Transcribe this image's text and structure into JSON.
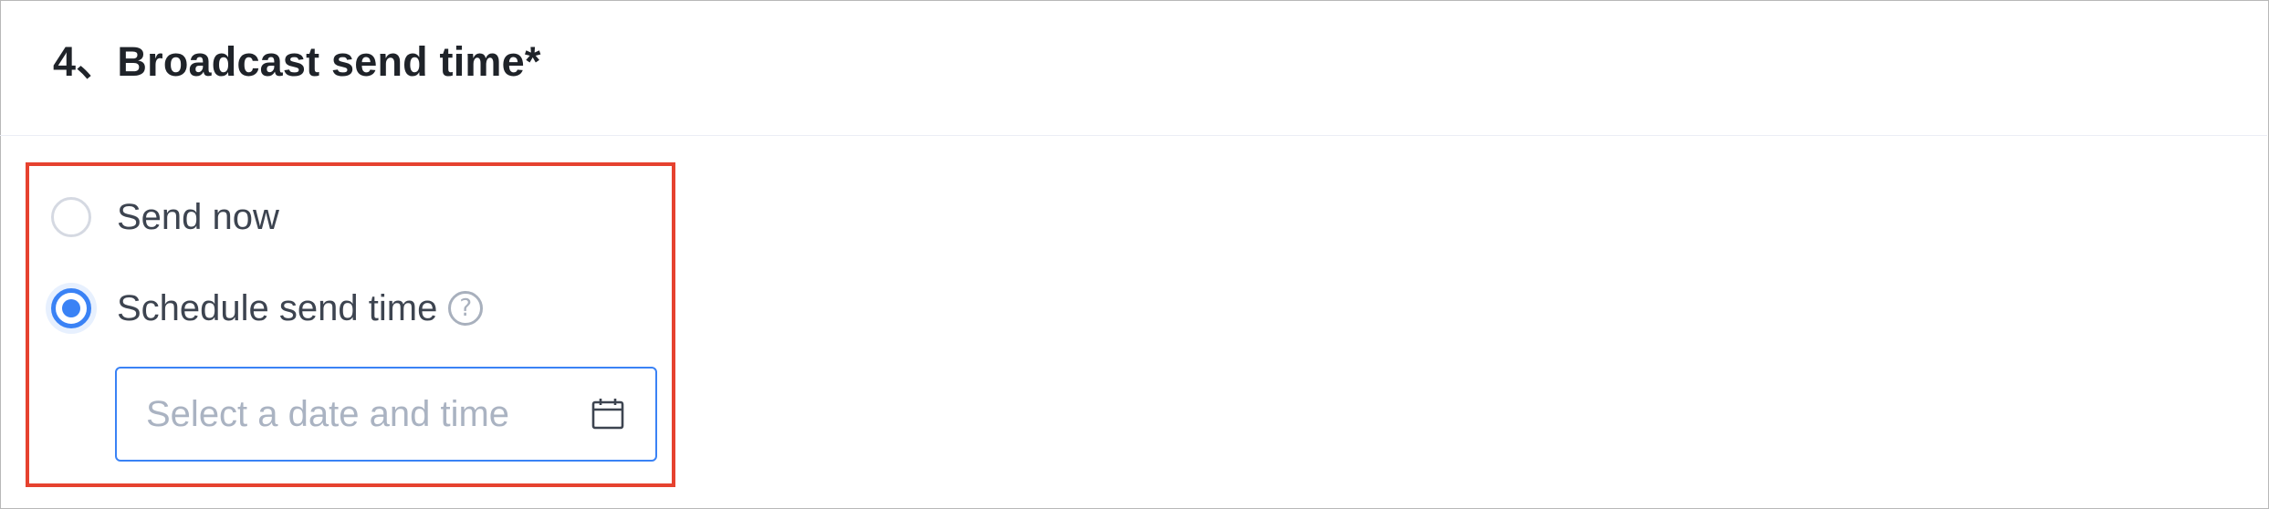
{
  "section": {
    "title": "4、Broadcast send time*"
  },
  "options": [
    {
      "label": "Send now",
      "selected": false
    },
    {
      "label": "Schedule send time",
      "selected": true
    }
  ],
  "help_icon": {
    "icon": "question-circle-icon",
    "glyph": "?"
  },
  "date_picker": {
    "placeholder": "Select a date and time",
    "value": "",
    "icon": "calendar-icon"
  },
  "colors": {
    "accent": "#3a82f5",
    "highlight": "#e6422f",
    "placeholder": "#aab3c2",
    "title": "#1f2329"
  }
}
